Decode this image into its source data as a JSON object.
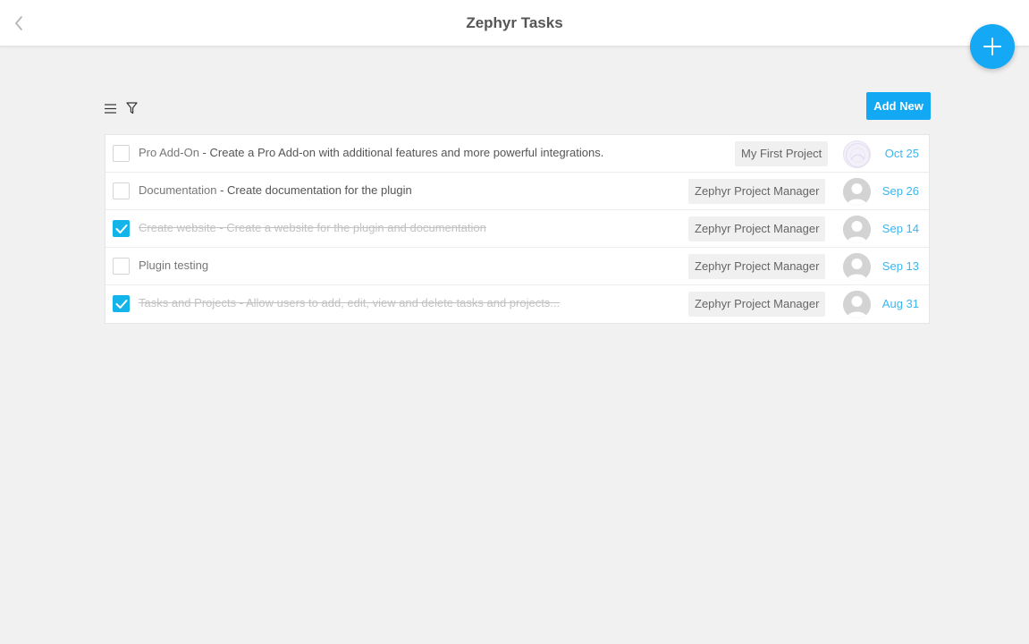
{
  "header": {
    "title": "Zephyr Tasks",
    "back_icon": "chevron-left-icon",
    "fab_icon": "plus-icon"
  },
  "toolbar": {
    "menu_icon": "hamburger-menu-icon",
    "filter_icon": "filter-icon",
    "add_new_label": "Add New"
  },
  "colors": {
    "accent": "#12a8f4",
    "date": "#3bb5f0",
    "checkbox_checked": "#12b4ea"
  },
  "tasks": [
    {
      "title": "Pro Add-On",
      "separator": " - ",
      "description": "Create a Pro Add-on with additional features and more powerful integrations.",
      "project": "My First Project",
      "date": "Oct 25",
      "completed": false,
      "avatar": "custom-avatar-icon"
    },
    {
      "title": "Documentation",
      "separator": " - ",
      "description": "Create documentation for the plugin",
      "project": "Zephyr Project Manager",
      "date": "Sep 26",
      "completed": false,
      "avatar": "default-user-avatar-icon"
    },
    {
      "title": "Create website",
      "separator": " - ",
      "description": "Create a website for the plugin and documentation",
      "project": "Zephyr Project Manager",
      "date": "Sep 14",
      "completed": true,
      "avatar": "default-user-avatar-icon"
    },
    {
      "title": "Plugin testing",
      "separator": "",
      "description": "",
      "project": "Zephyr Project Manager",
      "date": "Sep 13",
      "completed": false,
      "avatar": "default-user-avatar-icon"
    },
    {
      "title": "Tasks and Projects",
      "separator": " - ",
      "description": "Allow users to add, edit, view and delete tasks and projects...",
      "project": "Zephyr Project Manager",
      "date": "Aug 31",
      "completed": true,
      "avatar": "default-user-avatar-icon"
    }
  ]
}
